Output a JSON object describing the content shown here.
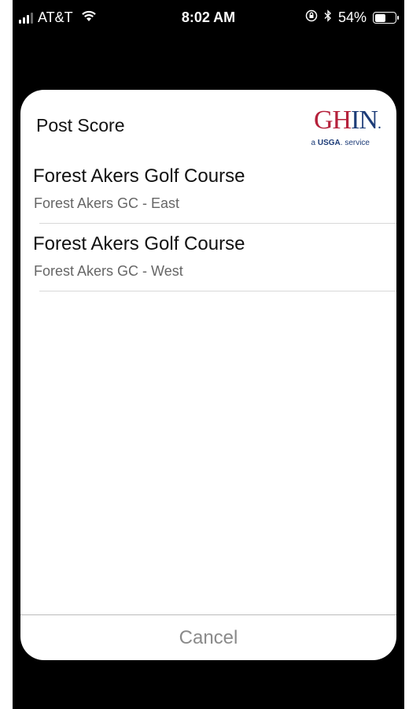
{
  "status_bar": {
    "carrier": "AT&T",
    "time": "8:02 AM",
    "battery": "54%",
    "battery_level": 0.54,
    "icons": [
      "signal-icon",
      "wifi-icon",
      "orientation-lock-icon",
      "bluetooth-icon",
      "battery-icon"
    ]
  },
  "sheet": {
    "title": "Post Score",
    "logo": {
      "main_red": "GH",
      "main_blue": "IN",
      "dot": ".",
      "sub_prefix": "a ",
      "sub_brand": "USGA",
      "sub_suffix": ". service"
    },
    "courses": [
      {
        "name": "Forest Akers Golf Course",
        "subtitle": "Forest Akers GC - East"
      },
      {
        "name": "Forest Akers Golf Course",
        "subtitle": "Forest Akers GC - West"
      }
    ],
    "cancel_label": "Cancel"
  },
  "colors": {
    "background": "#000000",
    "sheet": "#ffffff",
    "logo_red": "#b5213b",
    "logo_blue": "#1d3c78",
    "secondary_text": "#666666",
    "cancel_text": "#8a8a8a"
  }
}
